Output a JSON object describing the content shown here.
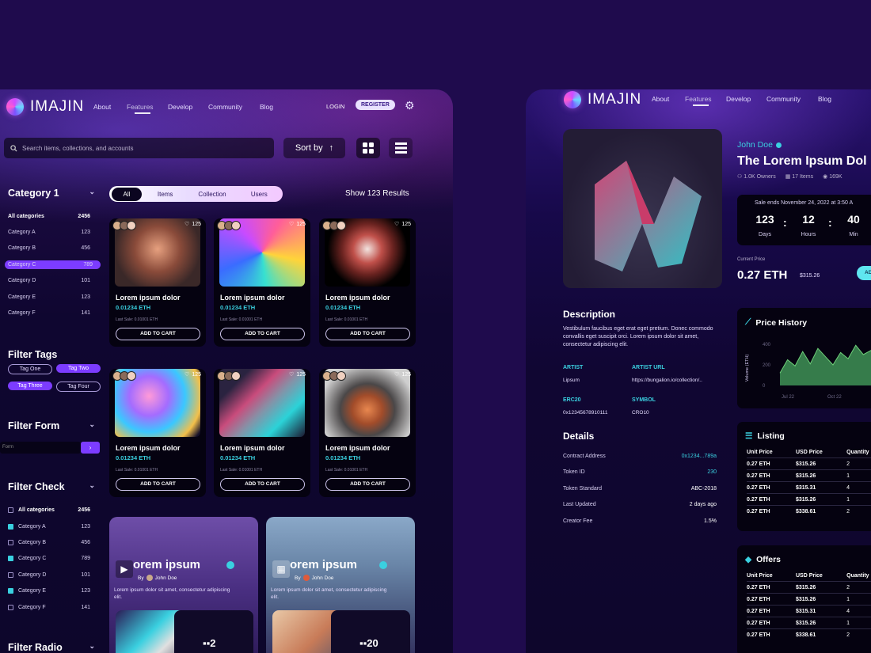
{
  "brand": "IMAJIN",
  "nav": [
    "About",
    "Features",
    "Develop",
    "Community",
    "Blog"
  ],
  "auth": {
    "login": "LOGIN",
    "register": "REGISTER"
  },
  "search": {
    "placeholder": "Search items, collections, and accounts"
  },
  "sort_label": "Sort by",
  "category1": {
    "title": "Category 1",
    "items": [
      {
        "label": "All categories",
        "count": "2456"
      },
      {
        "label": "Category A",
        "count": "123"
      },
      {
        "label": "Category B",
        "count": "456"
      },
      {
        "label": "Category C",
        "count": "789"
      },
      {
        "label": "Category D",
        "count": "101"
      },
      {
        "label": "Category E",
        "count": "123"
      },
      {
        "label": "Category F",
        "count": "141"
      }
    ]
  },
  "filter_tags": {
    "title": "Filter Tags",
    "tags": [
      "Tag One",
      "Tag Two",
      "Tag Three",
      "Tag Four"
    ]
  },
  "filter_form": {
    "title": "Filter Form",
    "placeholder": "Form"
  },
  "filter_check": {
    "title": "Filter Check",
    "items": [
      {
        "label": "All categories",
        "count": "2456"
      },
      {
        "label": "Category A",
        "count": "123"
      },
      {
        "label": "Category B",
        "count": "456"
      },
      {
        "label": "Category C",
        "count": "789"
      },
      {
        "label": "Category D",
        "count": "101"
      },
      {
        "label": "Category E",
        "count": "123"
      },
      {
        "label": "Category F",
        "count": "141"
      }
    ]
  },
  "filter_radio": {
    "title": "Filter Radio"
  },
  "tabs": [
    "All",
    "Items",
    "Collection",
    "Users"
  ],
  "results": "Show 123 Results",
  "cards": [
    {
      "likes": "125",
      "title": "Lorem ipsum dolor",
      "price": "0.01234 ETH",
      "last": "Last Sale: 0.01001 ETH",
      "cta": "ADD TO CART"
    },
    {
      "likes": "125",
      "title": "Lorem ipsum dolor",
      "price": "0.01234 ETH",
      "last": "Last Sale: 0.01001 ETH",
      "cta": "ADD TO CART"
    },
    {
      "likes": "125",
      "title": "Lorem ipsum dolor",
      "price": "0.01234 ETH",
      "last": "Last Sale: 0.01001 ETH",
      "cta": "ADD TO CART"
    },
    {
      "likes": "125",
      "title": "Lorem ipsum dolor",
      "price": "0.01234 ETH",
      "last": "Last Sale: 0.01001 ETH",
      "cta": "ADD TO CART"
    },
    {
      "likes": "125",
      "title": "Lorem ipsum dolor",
      "price": "0.01234 ETH",
      "last": "Last Sale: 0.01001 ETH",
      "cta": "ADD TO CART"
    },
    {
      "likes": "125",
      "title": "Lorem ipsum dolor",
      "price": "0.01234 ETH",
      "last": "Last Sale: 0.01001 ETH",
      "cta": "ADD TO CART"
    }
  ],
  "collections": [
    {
      "title": "orem ipsum",
      "by": "By",
      "author": "John Doe",
      "desc": "Lorem ipsum dolor sit amet, consectetur adipiscing elit.",
      "count": "2"
    },
    {
      "title": "orem ipsum",
      "by": "By",
      "author": "John Doe",
      "desc": "Lorem ipsum dolor sit amet, consectetur adipiscing elit.",
      "count": "20"
    }
  ],
  "detail": {
    "artist": "John Doe",
    "title": "The Lorem Ipsum Dol",
    "owners": "1.0K Owners",
    "items": "17 Items",
    "views": "169K",
    "sale": "Sale ends November 24, 2022 at 3:50 A",
    "timer": [
      {
        "v": "123",
        "l": "Days"
      },
      {
        "v": "12",
        "l": "Hours"
      },
      {
        "v": "40",
        "l": "Min"
      }
    ],
    "current_label": "Current Price",
    "current": "0.27 ETH",
    "usd": "$315.26",
    "add": "ADD TO",
    "description_title": "Description",
    "description": "Vestibulum faucibus eget erat eget pretium. Donec commodo convallis eget suscipit orci. Lorem ipsum dolor sit amet, consectetur adipiscing elit.",
    "meta": [
      {
        "k": "ARTIST",
        "v": "Lipsum"
      },
      {
        "k": "ARTIST URL",
        "v": "https://bungalion.io/collection/.."
      },
      {
        "k": "ERC20",
        "v": "0x12345678910111"
      },
      {
        "k": "SYMBOL",
        "v": "CRO10"
      }
    ],
    "details_title": "Details",
    "details": [
      {
        "k": "Contract Address",
        "v": "0x1234...789a"
      },
      {
        "k": "Token ID",
        "v": "230"
      },
      {
        "k": "Token Standard",
        "v": "ABC-2018"
      },
      {
        "k": "Last Updated",
        "v": "2 days ago"
      },
      {
        "k": "Creator Fee",
        "v": "1.5%"
      }
    ],
    "price_history_title": "Price History",
    "listing_title": "Listing",
    "offers_title": "Offers",
    "table_head": [
      "Unit Price",
      "USD Price",
      "Quantity"
    ],
    "listing": [
      [
        "0.27 ETH",
        "$315.26",
        "2"
      ],
      [
        "0.27 ETH",
        "$315.26",
        "1"
      ],
      [
        "0.27 ETH",
        "$315.31",
        "4"
      ],
      [
        "0.27 ETH",
        "$315.26",
        "1"
      ],
      [
        "0.27 ETH",
        "$338.61",
        "2"
      ]
    ],
    "offers": [
      [
        "0.27 ETH",
        "$315.26",
        "2"
      ],
      [
        "0.27 ETH",
        "$315.26",
        "1"
      ],
      [
        "0.27 ETH",
        "$315.31",
        "4"
      ],
      [
        "0.27 ETH",
        "$315.26",
        "1"
      ],
      [
        "0.27 ETH",
        "$338.61",
        "2"
      ]
    ]
  },
  "chart_data": {
    "type": "area",
    "ylabel": "Volume (ETH)",
    "yticks": [
      "400",
      "200",
      "0"
    ],
    "xticks": [
      "Jul 22",
      "Oct 22"
    ],
    "values": [
      120,
      250,
      190,
      330,
      210,
      360,
      280,
      200,
      320,
      260,
      390,
      300,
      340,
      310,
      280
    ]
  },
  "colors": {
    "accent": "#7c3cff",
    "cyan": "#3ad0e0",
    "bg": "#1f0b4d"
  }
}
